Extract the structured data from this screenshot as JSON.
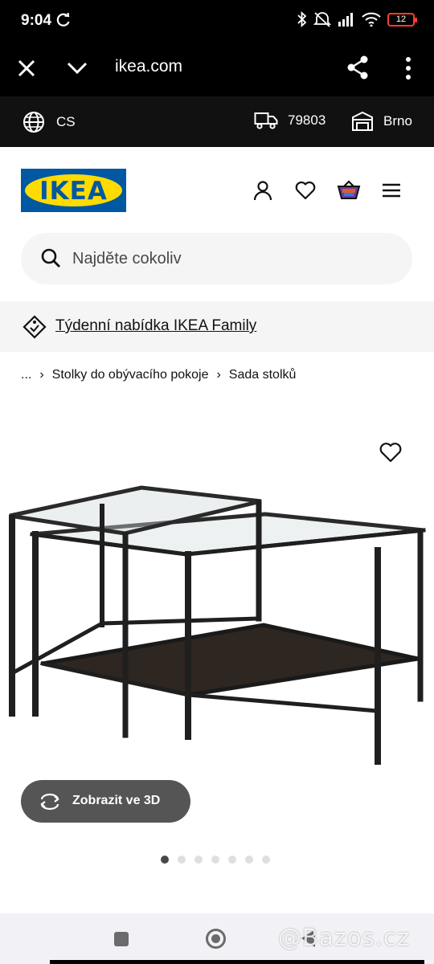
{
  "status_bar": {
    "time": "9:04",
    "battery": "12",
    "icons": [
      "sync-icon",
      "bluetooth-icon",
      "mute-icon",
      "signal-icon",
      "wifi-icon",
      "battery-icon"
    ]
  },
  "browser": {
    "url": "ikea.com",
    "icons": [
      "close-icon",
      "chevron-down-icon",
      "share-icon",
      "more-vertical-icon"
    ]
  },
  "top_strip": {
    "language": "CS",
    "postal_code": "79803",
    "store": "Brno"
  },
  "header": {
    "logo_text": "IKEA",
    "icons": [
      "user-icon",
      "heart-icon",
      "basket-icon",
      "menu-icon"
    ]
  },
  "search": {
    "placeholder": "Najděte cokoliv"
  },
  "family_banner": {
    "label": "Týdenní nabídka IKEA Family"
  },
  "breadcrumb": {
    "items": [
      "...",
      "Stolky do obývacího pokoje",
      "Sada stolků"
    ]
  },
  "product": {
    "view_3d_label": "Zobrazit ve 3D",
    "image_count": 7,
    "active_image": 1
  },
  "watermark": "@Bazos.cz",
  "colors": {
    "ikea_blue": "#0058a3",
    "ikea_yellow": "#ffdb00",
    "battery_red": "#ff3b30",
    "button_gray": "#555555"
  }
}
